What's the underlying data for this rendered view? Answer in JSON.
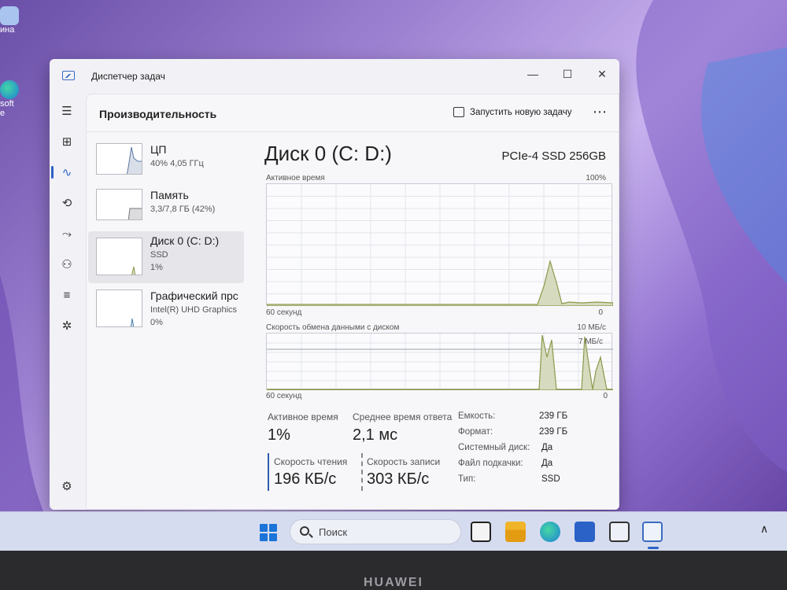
{
  "desktop": {
    "icons": [
      {
        "label": "ина",
        "icon": "recycle-bin-icon"
      },
      {
        "label": "soft\ne",
        "icon": "edge-icon"
      }
    ]
  },
  "window": {
    "title": "Диспетчер задач",
    "controls": {
      "minimize": "—",
      "maximize": "☐",
      "close": "✕"
    }
  },
  "sidebar": {
    "items": [
      {
        "icon": "hamburger-menu-icon",
        "glyph": "☰"
      },
      {
        "icon": "processes-icon",
        "glyph": "⊞"
      },
      {
        "icon": "performance-icon",
        "glyph": "∿",
        "active": true
      },
      {
        "icon": "app-history-icon",
        "glyph": "⟲"
      },
      {
        "icon": "startup-apps-icon",
        "glyph": "⤳"
      },
      {
        "icon": "users-icon",
        "glyph": "⚇"
      },
      {
        "icon": "details-icon",
        "glyph": "≡"
      },
      {
        "icon": "services-icon",
        "glyph": "✲"
      }
    ],
    "settings_glyph": "⚙"
  },
  "header": {
    "title": "Производительность",
    "run_task": "Запустить новую задачу",
    "more": "⋯"
  },
  "resources": [
    {
      "name": "ЦП",
      "line1": "40%  4,05 ГГц",
      "line2": ""
    },
    {
      "name": "Память",
      "line1": "3,3/7,8 ГБ (42%)",
      "line2": ""
    },
    {
      "name": "Диск 0 (C: D:)",
      "line1": "SSD",
      "line2": "1%",
      "selected": true
    },
    {
      "name": "Графический прс",
      "line1": "Intel(R) UHD Graphics",
      "line2": "0%"
    }
  ],
  "detail": {
    "title": "Диск 0 (C: D:)",
    "model": "PCIe-4 SSD 256GB",
    "graph1": {
      "label": "Активное время",
      "max": "100%",
      "time": "60 секунд",
      "min": "0"
    },
    "graph2": {
      "label": "Скорость обмена данными с диском",
      "max": "10 МБ/с",
      "mid": "7 МБ/с",
      "time": "60 секунд",
      "min": "0"
    },
    "stats": {
      "active_label": "Активное время",
      "active_value": "1%",
      "response_label": "Среднее время ответа",
      "response_value": "2,1 мс",
      "read_label": "Скорость чтения",
      "read_value": "196 КБ/с",
      "write_label": "Скорость записи",
      "write_value": "303 КБ/с"
    },
    "props": [
      {
        "k": "Емкость:",
        "v": "239 ГБ"
      },
      {
        "k": "Формат:",
        "v": "239 ГБ"
      },
      {
        "k": "Системный диск:",
        "v": "Да"
      },
      {
        "k": "Файл подкачки:",
        "v": "Да"
      },
      {
        "k": "Тип:",
        "v": "SSD"
      }
    ]
  },
  "taskbar": {
    "search_placeholder": "Поиск",
    "chevron": "∧"
  },
  "device_brand": "HUAWEI",
  "colors": {
    "accent": "#2b62c7",
    "graph_fill": "#d6dabf",
    "graph_line": "#8a9a4a"
  }
}
